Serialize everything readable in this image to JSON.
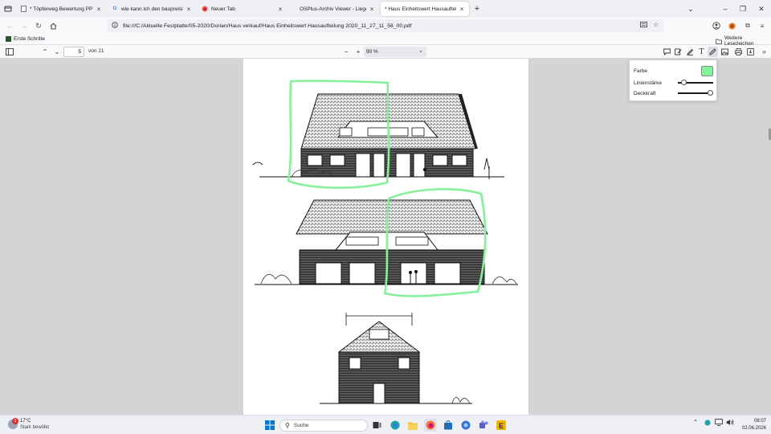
{
  "tabs": [
    {
      "title": "* Töpferweg Bewertung PP - Töpfer",
      "favicon": "document-icon",
      "active": false
    },
    {
      "title": "wie kann ich den baupreisinde:",
      "favicon": "google-icon",
      "active": false
    },
    {
      "title": "Neuer Tab",
      "favicon": "firefox-icon",
      "active": false
    },
    {
      "title": "OSPlus-Archiv Viewer - Liegenschaf",
      "favicon": "",
      "active": false
    },
    {
      "title": "* Haus Einheitswert Hausaufteilung",
      "favicon": "pdf-icon",
      "active": true
    }
  ],
  "address": {
    "url": "file:///C:/Aktuelle Festplatte/05-2020/Dorian/Haus verkauf/Haus Einheitswert Hausaufteilung 2020_11_27_11_58_00.pdf"
  },
  "bookmarks": {
    "left": "Erste Schritte",
    "right": "Weitere Lesezeichen"
  },
  "pdf_toolbar": {
    "page_number": "5",
    "page_of": "von 21",
    "zoom": "90 %"
  },
  "ink_popup": {
    "color_label": "Farbe",
    "color_value": "#86f09a",
    "thickness_label": "Linienstärke",
    "thickness_level": 0.1,
    "opacity_label": "Deckkraft",
    "opacity_level": 1.0
  },
  "annotation_color": "#86f09a",
  "taskbar": {
    "weather_badge": "1",
    "temperature": "17°C",
    "weather_condition": "Stark bewölkt",
    "search_label": "Suche",
    "time": "08:07",
    "date": "02.06.2026"
  }
}
